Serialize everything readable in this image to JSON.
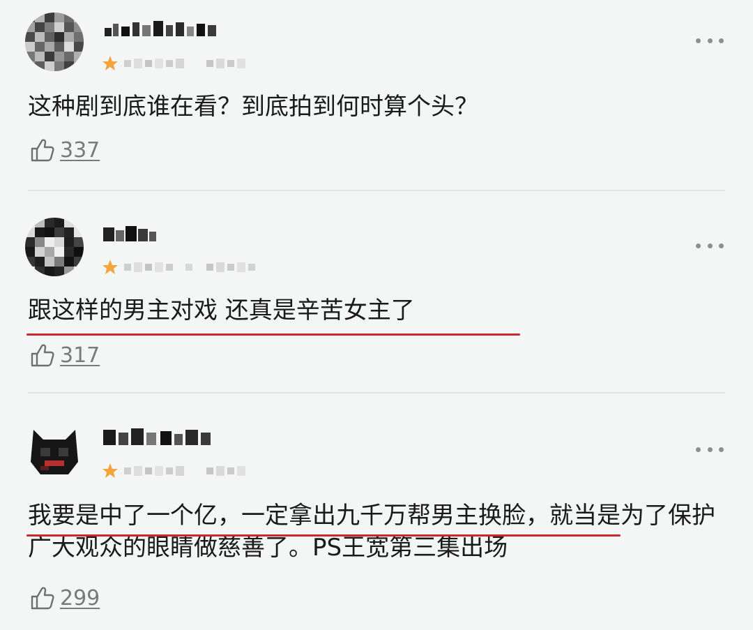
{
  "comments": [
    {
      "text": "这种剧到底谁在看？到底拍到何时算个头？",
      "likes": "337",
      "more_glyph": "•••",
      "like_icon": "thumbs-up-icon",
      "level_icon": "star-icon"
    },
    {
      "text": "跟这样的男主对戏 还真是辛苦女主了",
      "likes": "317",
      "more_glyph": "•••",
      "like_icon": "thumbs-up-icon",
      "level_icon": "star-icon"
    },
    {
      "text": "我要是中了一个亿，一定拿出九千万帮男主换脸，就当是为了保护广大观众的眼睛做慈善了。PS王宽第三集出场",
      "likes": "299",
      "more_glyph": "•••",
      "like_icon": "thumbs-up-icon",
      "level_icon": "star-icon"
    }
  ],
  "colors": {
    "background": "#f4f6f6",
    "underline": "#c8282d",
    "level_star": "#f3a43a",
    "muted_text": "#7a7a7a"
  }
}
